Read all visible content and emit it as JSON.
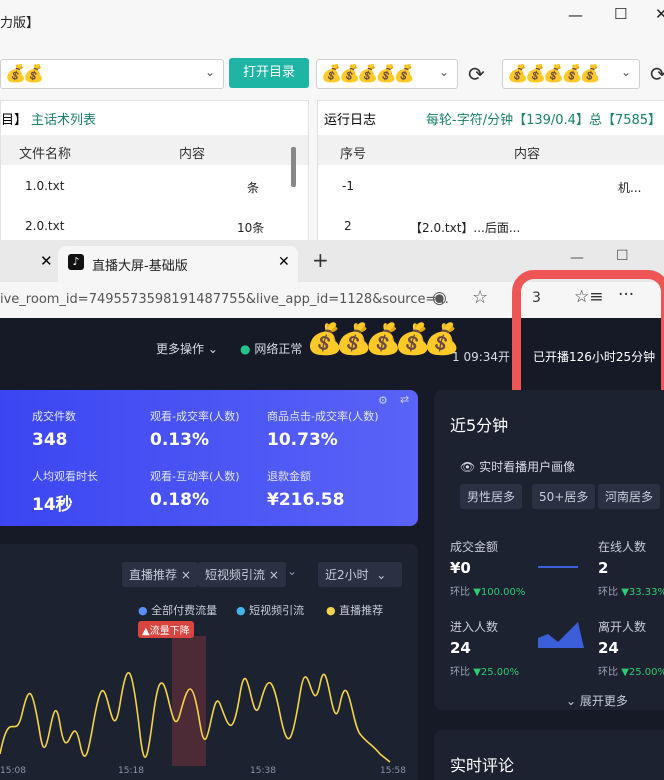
{
  "app": {
    "title": "力版】",
    "open_dir_label": "打开目录",
    "left_panel": {
      "heading_a": "目】",
      "heading_b": "主话术列表",
      "col_file": "文件名称",
      "col_content": "内容",
      "rows": [
        {
          "file": "1.0.txt",
          "content": "条"
        },
        {
          "file": "2.0.txt",
          "content": "10条"
        }
      ]
    },
    "right_panel": {
      "heading": "运行日志",
      "stats": "每轮-字符/分钟【139/0.4】总【7585】",
      "col_no": "序号",
      "col_content": "内容",
      "rows": [
        {
          "no": "-1",
          "content": "机..."
        },
        {
          "no": "2",
          "content": "【2.0.txt】...后面..."
        }
      ]
    }
  },
  "browser": {
    "tab_title": "直播大屏-基础版",
    "url": "ive_room_id=7495573598191487755&live_app_id=1128&source=...",
    "badge": "3"
  },
  "dash": {
    "more_ops": "更多操作",
    "network": "网络正常",
    "time_a": "1 09:34开",
    "time_b": "已开播126小时25分钟",
    "metrics": [
      {
        "label": "成交件数",
        "value": "348"
      },
      {
        "label": "观看-成交率(人数)",
        "value": "0.13%"
      },
      {
        "label": "商品点击-成交率(人数)",
        "value": "10.73%"
      },
      {
        "label": "人均观看时长",
        "value": "14秒"
      },
      {
        "label": "观看-互动率(人数)",
        "value": "0.18%"
      },
      {
        "label": "退款金额",
        "value": "¥216.58"
      }
    ],
    "filter_a": "直播推荐",
    "filter_b": "短视频引流",
    "range": "近2小时",
    "legend": [
      "全部付费流量",
      "短视频引流",
      "直播推荐"
    ],
    "alert": "流量下降",
    "xticks": [
      "15:08",
      "15:18",
      "15:38",
      "15:58"
    ],
    "panel_title": "近5分钟",
    "portrait": "实时看播用户画像",
    "tags": [
      "男性居多",
      "50+居多",
      "河南居多"
    ],
    "stats": [
      {
        "label": "成交金额",
        "value": "¥0",
        "cmp": "环比",
        "delta": "▼100.00%"
      },
      {
        "label": "在线人数",
        "value": "2",
        "cmp": "环比",
        "delta": "▼33.33%"
      },
      {
        "label": "进入人数",
        "value": "24",
        "cmp": "环比",
        "delta": "▼25.00%"
      },
      {
        "label": "离开人数",
        "value": "24",
        "cmp": "环比",
        "delta": "▼25.00%"
      }
    ],
    "expand": "展开更多",
    "comments": "实时评论"
  }
}
